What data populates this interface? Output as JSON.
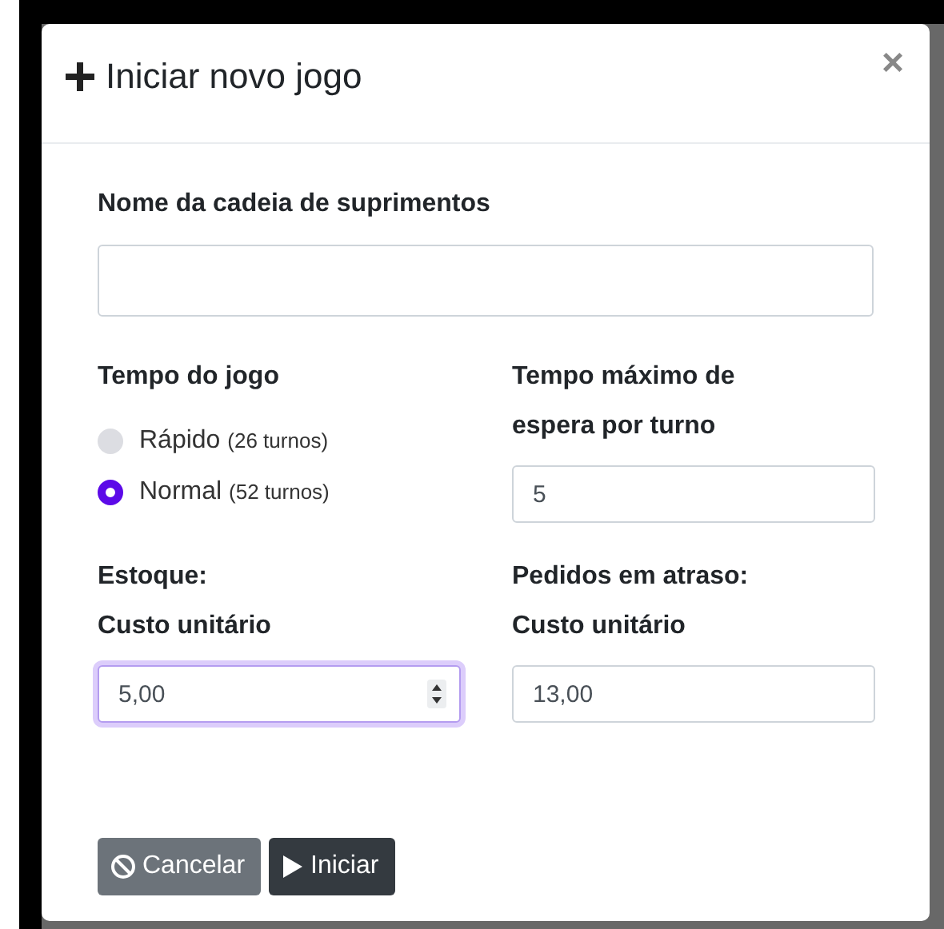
{
  "dialog": {
    "title": "Iniciar novo jogo",
    "close": "×"
  },
  "chain_name": {
    "label": "Nome da cadeia de suprimentos"
  },
  "game_time": {
    "label": "Tempo do jogo",
    "options": [
      {
        "label": "Rápido",
        "note": "(26 turnos)",
        "selected": false
      },
      {
        "label": "Normal",
        "note": "(52 turnos)",
        "selected": true
      }
    ]
  },
  "max_wait": {
    "label": "Tempo máximo de espera por turno",
    "value": "5"
  },
  "stock_cost": {
    "label_lines": [
      "Estoque:",
      "Custo unitário"
    ],
    "value": "5,00",
    "focused": true
  },
  "backorder_cost": {
    "label_lines": [
      "Pedidos em atraso:",
      "Custo unitário"
    ],
    "value": "13,00",
    "focused": false
  },
  "buttons": [
    {
      "label": "Cancelar",
      "kind": "cancel"
    },
    {
      "label": "Iniciar",
      "kind": "start"
    }
  ]
}
